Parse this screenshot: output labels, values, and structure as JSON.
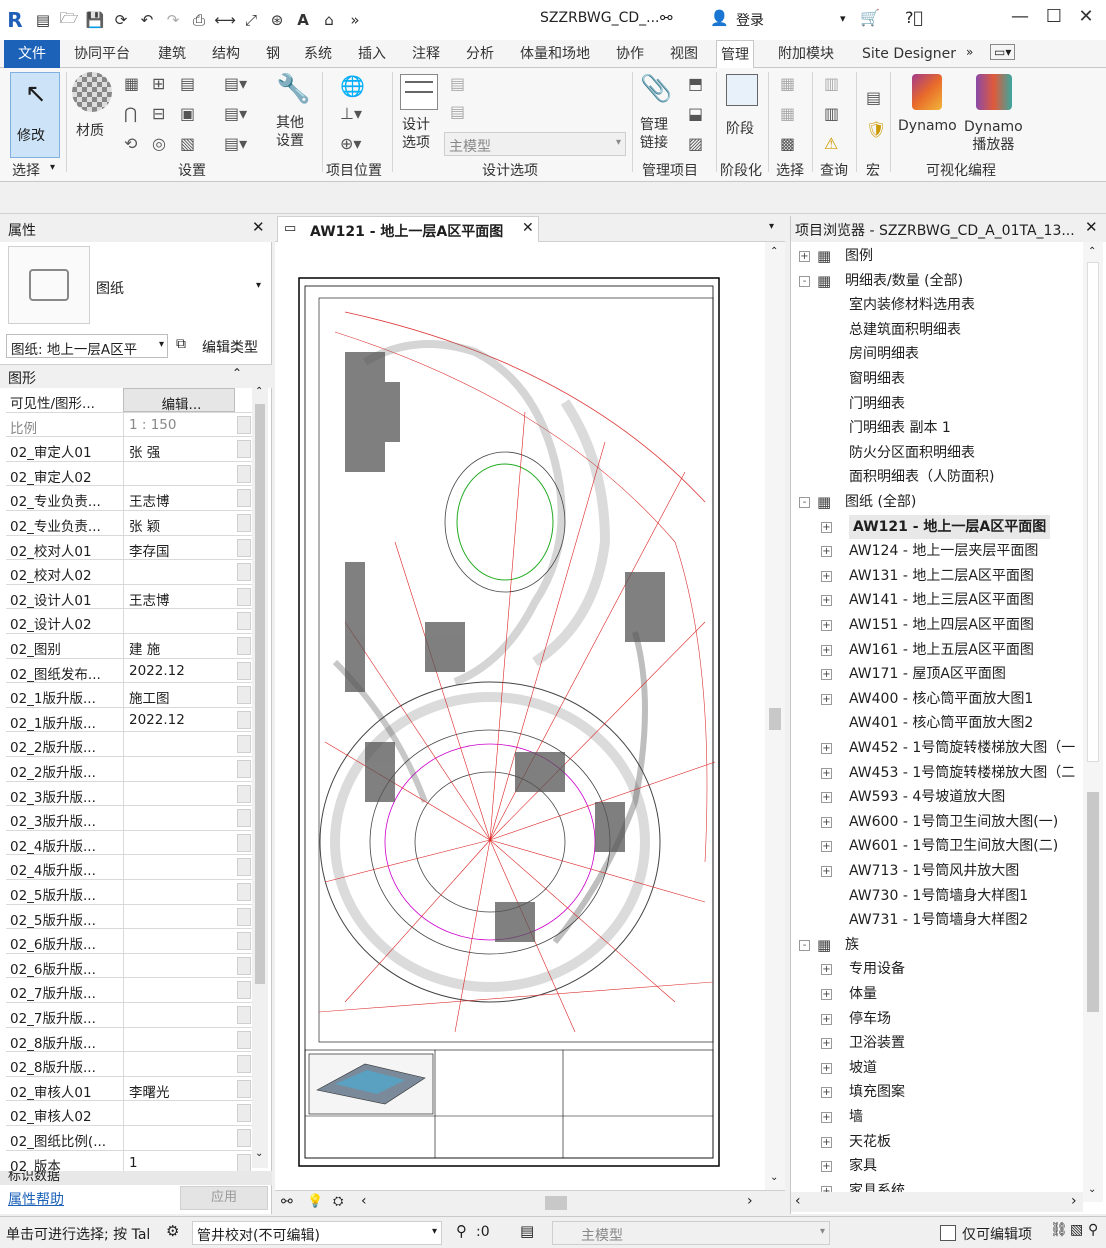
{
  "titlebar": {
    "doc_title": "SZZRBWG_CD_...",
    "login": "登录"
  },
  "tabs": [
    "文件",
    "协同平台",
    "建筑",
    "结构",
    "钢",
    "系统",
    "插入",
    "注释",
    "分析",
    "体量和场地",
    "协作",
    "视图",
    "管理",
    "附加模块",
    "Site Designer"
  ],
  "ribbon": {
    "modify": "修改",
    "material": "材质",
    "other_settings": "其他\n设置",
    "design_options": "设计\n选项",
    "main_model": "主模型",
    "manage_links": "管理\n链接",
    "phases": "阶段",
    "dynamo": "Dynamo",
    "dynamo_player": "Dynamo\n播放器",
    "groups": {
      "select": "选择",
      "settings": "设置",
      "project_location": "项目位置",
      "design_options": "设计选项",
      "manage_project": "管理项目",
      "phasing": "阶段化",
      "selection": "选择",
      "inquiry": "查询",
      "macros": "宏",
      "visual_programming": "可视化编程"
    }
  },
  "properties": {
    "title": "属性",
    "type_name": "图纸",
    "selector": "图纸: 地上一层A区平",
    "edit_type": "编辑类型",
    "section_graphics": "图形",
    "rows": [
      {
        "k": "可见性/图形...",
        "v": "编辑..."
      },
      {
        "k": "比例",
        "v": "1 : 150"
      },
      {
        "k": "02_审定人01",
        "v": "张  强"
      },
      {
        "k": "02_审定人02",
        "v": ""
      },
      {
        "k": "02_专业负责...",
        "v": "王志博"
      },
      {
        "k": "02_专业负责...",
        "v": "张  颖"
      },
      {
        "k": "02_校对人01",
        "v": "李存国"
      },
      {
        "k": "02_校对人02",
        "v": ""
      },
      {
        "k": "02_设计人01",
        "v": "王志博"
      },
      {
        "k": "02_设计人02",
        "v": ""
      },
      {
        "k": "02_图别",
        "v": "建  施"
      },
      {
        "k": "02_图纸发布...",
        "v": "2022.12"
      },
      {
        "k": "02_1版升版...",
        "v": "施工图"
      },
      {
        "k": "02_1版升版...",
        "v": "2022.12"
      },
      {
        "k": "02_2版升版...",
        "v": ""
      },
      {
        "k": "02_2版升版...",
        "v": ""
      },
      {
        "k": "02_3版升版...",
        "v": ""
      },
      {
        "k": "02_3版升版...",
        "v": ""
      },
      {
        "k": "02_4版升版...",
        "v": ""
      },
      {
        "k": "02_4版升版...",
        "v": ""
      },
      {
        "k": "02_5版升版...",
        "v": ""
      },
      {
        "k": "02_5版升版...",
        "v": ""
      },
      {
        "k": "02_6版升版...",
        "v": ""
      },
      {
        "k": "02_6版升版...",
        "v": ""
      },
      {
        "k": "02_7版升版...",
        "v": ""
      },
      {
        "k": "02_7版升版...",
        "v": ""
      },
      {
        "k": "02_8版升版...",
        "v": ""
      },
      {
        "k": "02_8版升版...",
        "v": ""
      },
      {
        "k": "02_审核人01",
        "v": "李曙光"
      },
      {
        "k": "02_审核人02",
        "v": ""
      },
      {
        "k": "02_图纸比例(...",
        "v": ""
      },
      {
        "k": "02_版本",
        "v": "1"
      }
    ],
    "next_section": "标识数据",
    "help": "属性帮助",
    "apply": "应用"
  },
  "view": {
    "tab_title": "AW121 - 地上一层A区平面图"
  },
  "browser": {
    "title": "项目浏览器 - SZZRBWG_CD_A_01TA_13...",
    "items": [
      {
        "t": "图例",
        "lvl": 0,
        "exp": "+",
        "icon": true
      },
      {
        "t": "明细表/数量 (全部)",
        "lvl": 0,
        "exp": "-",
        "icon": true
      },
      {
        "t": "室内装修材料选用表",
        "lvl": 1
      },
      {
        "t": "总建筑面积明细表",
        "lvl": 1
      },
      {
        "t": "房间明细表",
        "lvl": 1
      },
      {
        "t": "窗明细表",
        "lvl": 1
      },
      {
        "t": "门明细表",
        "lvl": 1
      },
      {
        "t": "门明细表 副本 1",
        "lvl": 1
      },
      {
        "t": "防火分区面积明细表",
        "lvl": 1
      },
      {
        "t": "面积明细表（人防面积)",
        "lvl": 1
      },
      {
        "t": "图纸 (全部)",
        "lvl": 0,
        "exp": "-",
        "icon": true
      },
      {
        "t": "AW121 - 地上一层A区平面图",
        "lvl": 1,
        "exp": "+",
        "bold": true
      },
      {
        "t": "AW124 - 地上一层夹层平面图",
        "lvl": 1,
        "exp": "+"
      },
      {
        "t": "AW131 - 地上二层A区平面图",
        "lvl": 1,
        "exp": "+"
      },
      {
        "t": "AW141 - 地上三层A区平面图",
        "lvl": 1,
        "exp": "+"
      },
      {
        "t": "AW151 - 地上四层A区平面图",
        "lvl": 1,
        "exp": "+"
      },
      {
        "t": "AW161 - 地上五层A区平面图",
        "lvl": 1,
        "exp": "+"
      },
      {
        "t": "AW171 - 屋顶A区平面图",
        "lvl": 1,
        "exp": "+"
      },
      {
        "t": "AW400 - 核心筒平面放大图1",
        "lvl": 1,
        "exp": "+"
      },
      {
        "t": "AW401 - 核心筒平面放大图2",
        "lvl": 1
      },
      {
        "t": "AW452 - 1号筒旋转楼梯放大图（一",
        "lvl": 1,
        "exp": "+"
      },
      {
        "t": "AW453 - 1号筒旋转楼梯放大图（二",
        "lvl": 1,
        "exp": "+"
      },
      {
        "t": "AW593 - 4号坡道放大图",
        "lvl": 1,
        "exp": "+"
      },
      {
        "t": "AW600 - 1号筒卫生间放大图(一)",
        "lvl": 1,
        "exp": "+"
      },
      {
        "t": "AW601 - 1号筒卫生间放大图(二)",
        "lvl": 1,
        "exp": "+"
      },
      {
        "t": "AW713 - 1号筒风井放大图",
        "lvl": 1,
        "exp": "+"
      },
      {
        "t": "AW730 - 1号筒墙身大样图1",
        "lvl": 1
      },
      {
        "t": "AW731 - 1号筒墙身大样图2",
        "lvl": 1
      },
      {
        "t": "族",
        "lvl": 0,
        "exp": "-",
        "icon": true
      },
      {
        "t": "专用设备",
        "lvl": 1,
        "exp": "+"
      },
      {
        "t": "体量",
        "lvl": 1,
        "exp": "+"
      },
      {
        "t": "停车场",
        "lvl": 1,
        "exp": "+"
      },
      {
        "t": "卫浴装置",
        "lvl": 1,
        "exp": "+"
      },
      {
        "t": "坡道",
        "lvl": 1,
        "exp": "+"
      },
      {
        "t": "填充图案",
        "lvl": 1,
        "exp": "+"
      },
      {
        "t": "墙",
        "lvl": 1,
        "exp": "+"
      },
      {
        "t": "天花板",
        "lvl": 1,
        "exp": "+"
      },
      {
        "t": "家具",
        "lvl": 1,
        "exp": "+"
      },
      {
        "t": "家具系统",
        "lvl": 1,
        "exp": "+"
      }
    ]
  },
  "status": {
    "hint": "单击可进行选择; 按 Tal",
    "workset": "管井校对(不可编辑)",
    "count": ":0",
    "model": "主模型",
    "editable_only": "仅可编辑项"
  },
  "colors": {
    "accent": "#1c62b8",
    "selected_tab": "#ffffff"
  }
}
